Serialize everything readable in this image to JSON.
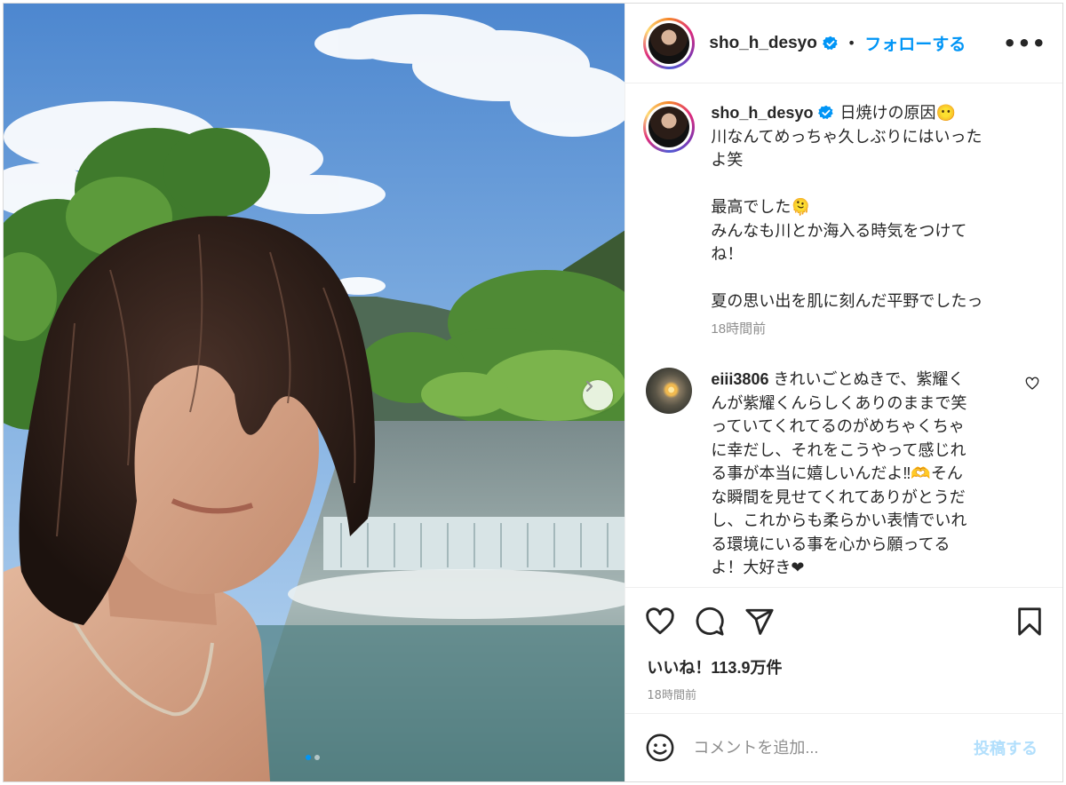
{
  "header": {
    "username": "sho_h_desyo",
    "separator": "•",
    "follow_label": "フォローする",
    "more_label": "•••"
  },
  "caption": {
    "username": "sho_h_desyo",
    "lines": [
      "日焼けの原因😶",
      "川なんてめっちゃ久しぶりにはいった",
      "よ笑",
      "",
      "最高でした🫠",
      "みんなも川とか海入る時気をつけて",
      "ね！",
      "",
      "夏の思い出を肌に刻んだ平野でしたっ"
    ],
    "time": "18時間前"
  },
  "comment": {
    "username": "eiii3806",
    "text": "きれいごとぬきで、紫耀く\nんが紫耀くんらしくありのままで笑\nっていてくれてるのがめちゃくちゃ\nに幸だし、それをこうやって感じれ\nる事が本当に嬉しいんだよ‼︎🫶そん\nな瞬間を見せてくれてありがとうだ\nし、これからも柔らかい表情でいれ\nる環境にいる事を心から願ってる\nよ！大好き❤"
  },
  "likes": "いいね！113.9万件",
  "post_time": "18時間前",
  "add_comment": {
    "placeholder": "コメントを追加...",
    "post_label": "投稿する"
  },
  "carousel": {
    "total": 2,
    "current": 1
  },
  "colors": {
    "accent": "#0095f6",
    "verified": "#0095f6"
  },
  "icons": [
    "verified-icon",
    "more-icon",
    "heart-icon",
    "comment-icon",
    "share-icon",
    "save-icon",
    "emoji-icon",
    "chevron-right-icon"
  ]
}
